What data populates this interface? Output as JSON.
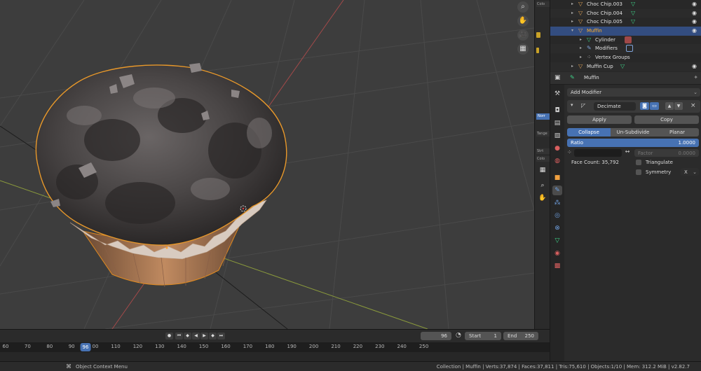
{
  "colors": {
    "accent": "#4772b3",
    "selected_row": "#334d80",
    "active_object": "#ffaf29",
    "mesh_icon": "#3fd68a",
    "object_icon": "#e3a457",
    "viewport_bg": "#3d3d3d"
  },
  "viewport": {
    "nav_icons": [
      "zoom-icon",
      "pan-hand-icon",
      "camera-icon",
      "grid-perspective-icon"
    ],
    "nav_glyphs": [
      "⌕",
      "✋",
      "🎥",
      "▦"
    ]
  },
  "npanel": {
    "tags": [
      "Colo",
      "Norr",
      "Tange",
      "Strt",
      "Colo"
    ]
  },
  "outliner": {
    "rows": [
      {
        "label": "Choc Chip.003",
        "type": "object"
      },
      {
        "label": "Choc Chip.004",
        "type": "object"
      },
      {
        "label": "Choc Chip.005",
        "type": "object"
      },
      {
        "label": "Muffin",
        "type": "object",
        "selected": true
      },
      {
        "label": "Cylinder",
        "type": "mesh"
      },
      {
        "label": "Modifiers",
        "type": "modifiers"
      },
      {
        "label": "Vertex Groups",
        "type": "vgroups"
      },
      {
        "label": "Muffin Cup",
        "type": "object"
      }
    ]
  },
  "properties": {
    "object_name": "Muffin",
    "add_modifier": "Add Modifier",
    "modifier": {
      "name": "Decimate",
      "apply": "Apply",
      "copy": "Copy",
      "modes": [
        "Collapse",
        "Un-Subdivide",
        "Planar"
      ],
      "active_mode": "Collapse",
      "ratio_label": "Ratio",
      "ratio_value": "1.0000",
      "factor_label": "Factor",
      "factor_value": "0.0000",
      "face_count": "Face Count: 35,792",
      "triangulate": "Triangulate",
      "symmetry": "Symmetry",
      "symmetry_axis": "X"
    }
  },
  "timeline": {
    "current_frame": "96",
    "start_label": "Start",
    "start_value": "1",
    "end_label": "End",
    "end_value": "250",
    "ruler_ticks": [
      "60",
      "70",
      "80",
      "90",
      "100",
      "110",
      "120",
      "130",
      "140",
      "150",
      "160",
      "170",
      "180",
      "190",
      "200",
      "210",
      "220",
      "230",
      "240",
      "250"
    ],
    "playhead_label": "96"
  },
  "statusbar": {
    "context_menu": "Object Context Menu",
    "stats": "Collection | Muffin | Verts:37,874 | Faces:37,811 | Tris:75,610 | Objects:1/10 | Mem: 312.2 MiB | v2.82.7"
  }
}
